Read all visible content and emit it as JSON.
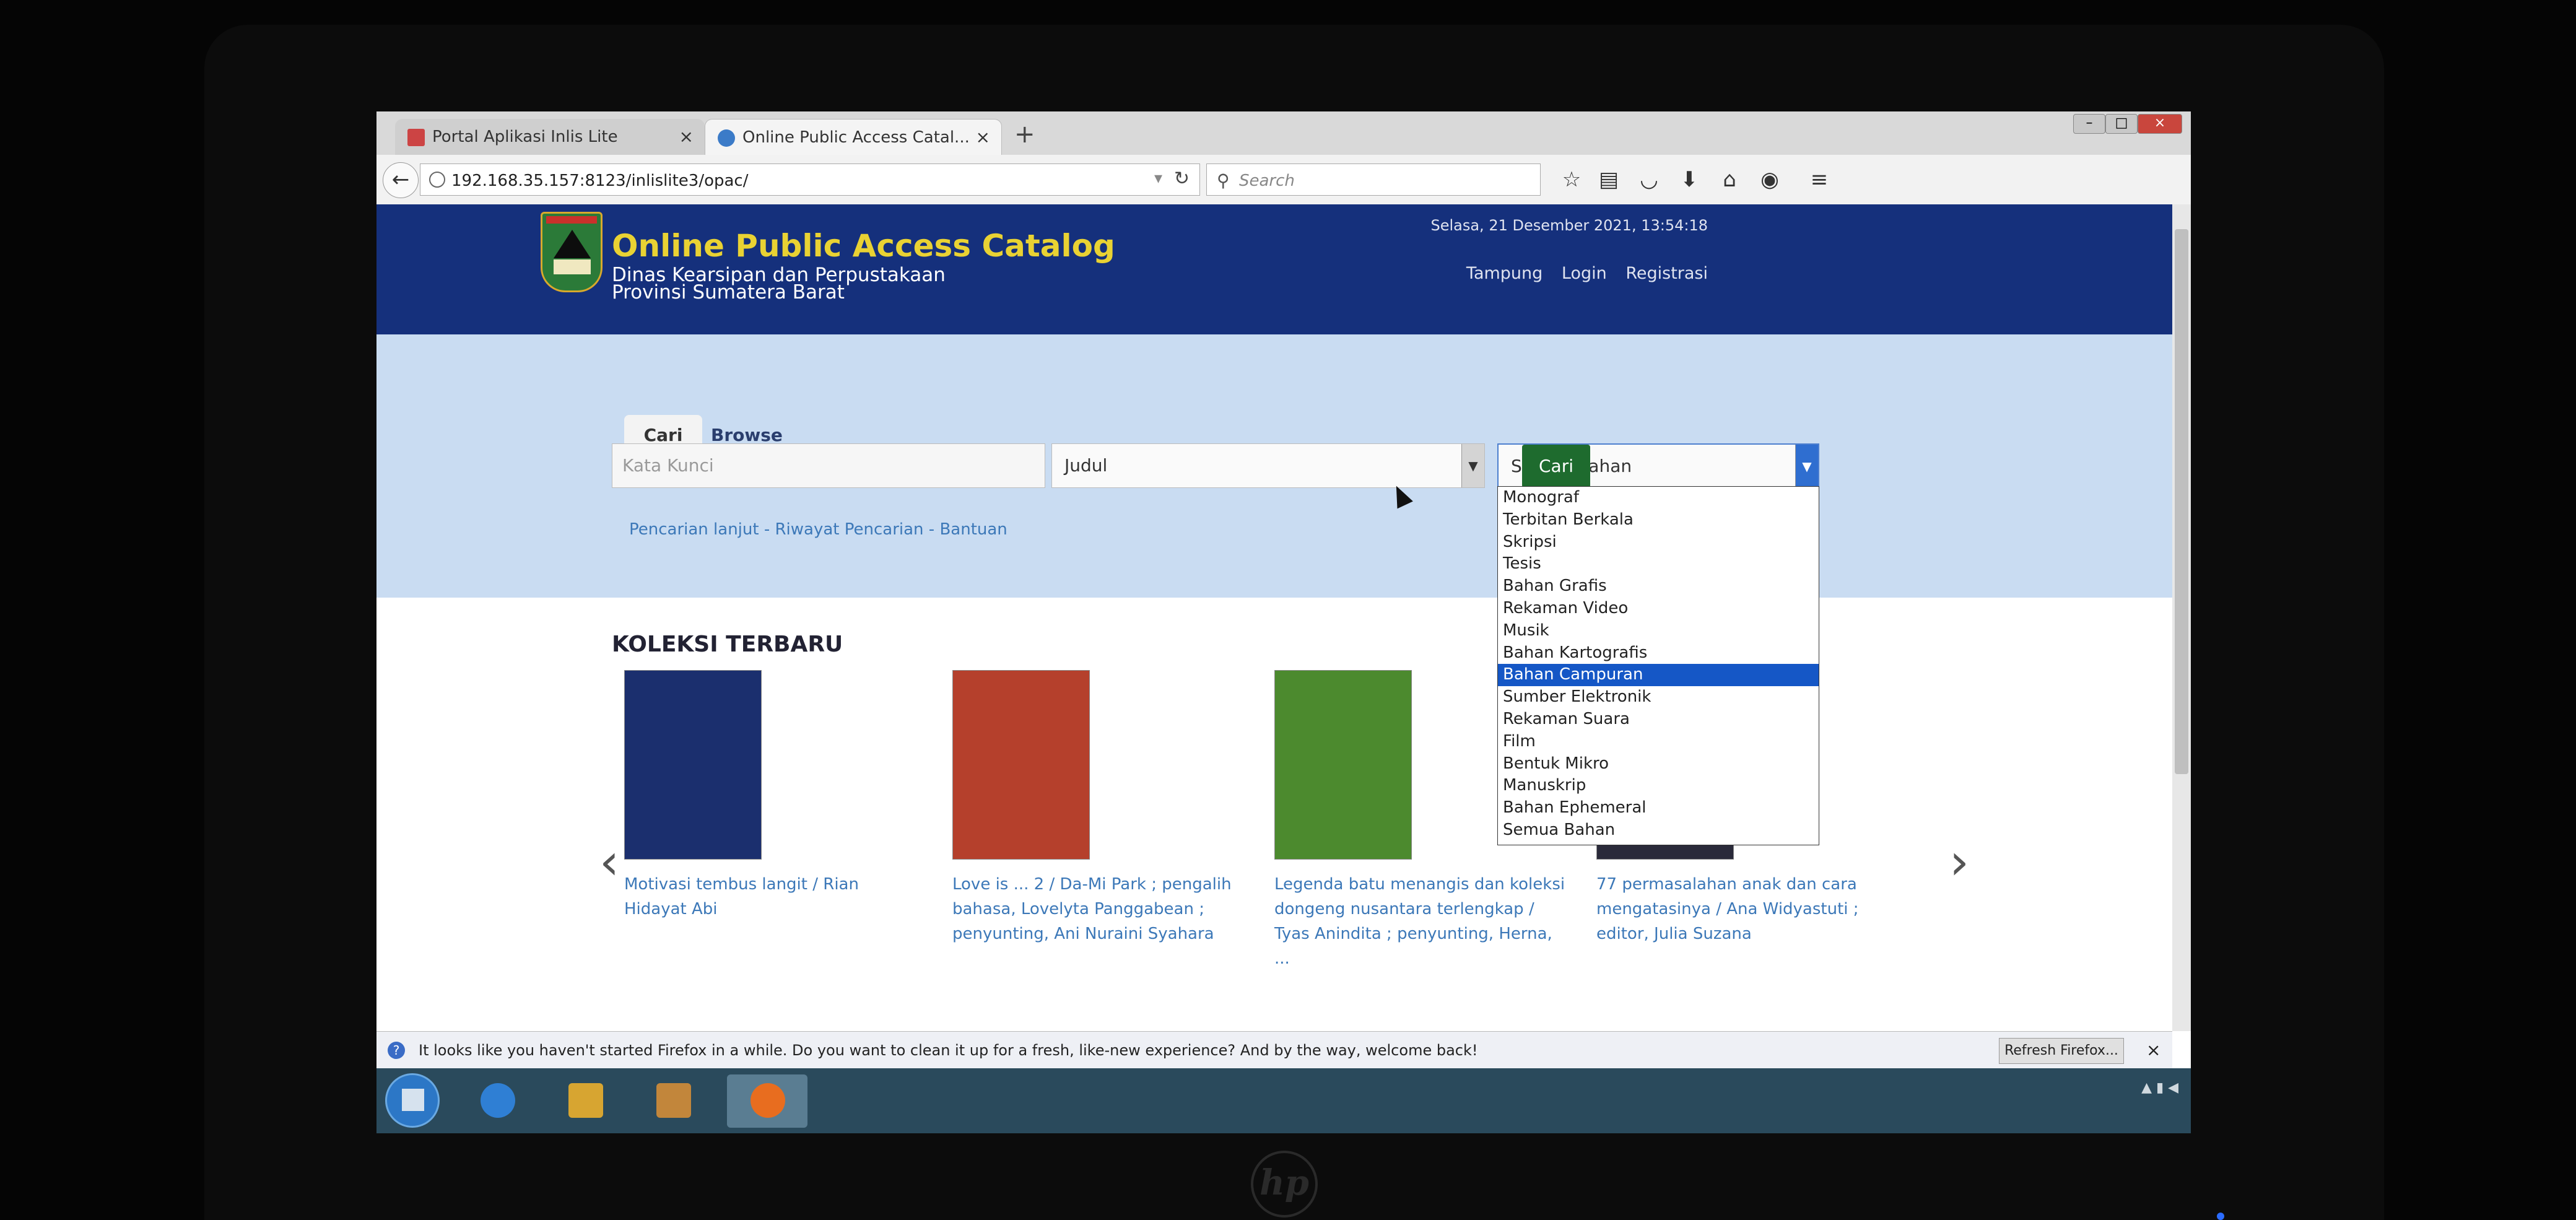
{
  "browser": {
    "tabs": [
      {
        "label": "Portal Aplikasi Inlis Lite",
        "active": false
      },
      {
        "label": "Online Public Access Catal...",
        "active": true
      }
    ],
    "new_tab": "+",
    "url": "192.168.35.157:8123/inlislite3/opac/",
    "search_placeholder": "Search"
  },
  "header": {
    "title": "Online Public Access Catalog",
    "subtitle": "Dinas Kearsipan dan Perpustakaan Provinsi Sumatera Barat",
    "datetime": "Selasa, 21 Desember 2021, 13:54:18",
    "links": [
      "Tampung",
      "Login",
      "Registrasi"
    ]
  },
  "search": {
    "tabs": [
      "Cari",
      "Browse"
    ],
    "keyword_placeholder": "Kata Kunci",
    "field_value": "Judul",
    "material_value": "Semua Bahan",
    "button": "Cari",
    "advanced_links": "Pencarian lanjut - Riwayat Pencarian - Bantuan",
    "material_options": [
      "Monograf",
      "Terbitan Berkala",
      "Skripsi",
      "Tesis",
      "Bahan Grafis",
      "Rekaman Video",
      "Musik",
      "Bahan Kartografis",
      "Bahan Campuran",
      "Sumber Elektronik",
      "Rekaman Suara",
      "Film",
      "Bentuk Mikro",
      "Manuskrip",
      "Bahan Ephemeral",
      "Semua Bahan"
    ],
    "highlighted_option": "Bahan Campuran"
  },
  "collection": {
    "heading": "KOLEKSI TERBARU",
    "books": [
      {
        "title": "Motivasi tembus langit / Rian Hidayat Abi",
        "color": "#1b2f6e"
      },
      {
        "title": "Love is ... 2 / Da-Mi Park ; pengalih bahasa, Lovelyta Panggabean ; penyunting, Ani Nuraini Syahara",
        "color": "#b5402c"
      },
      {
        "title": "Legenda batu menangis dan koleksi dongeng nusantara terlengkap / Tyas Anindita ; penyunting, Herna, ...",
        "color": "#4c8a2e"
      },
      {
        "title": "77 permasalahan anak dan cara mengatasinya / Ana Widyastuti ; editor, Julia Suzana",
        "color": "#2a2a3a"
      }
    ],
    "prev": "‹",
    "next": "›"
  },
  "notification": {
    "message": "It looks like you haven't started Firefox in a while. Do you want to clean it up for a fresh, like-new experience? And by the way, welcome back!",
    "button": "Refresh Firefox...",
    "close": "×"
  },
  "colors": {
    "header_bg": "#15307c",
    "title_yellow": "#e9d233",
    "search_button": "#1e6b2e",
    "link_blue": "#3c78b8",
    "dropdown_highlight": "#1557c6"
  }
}
